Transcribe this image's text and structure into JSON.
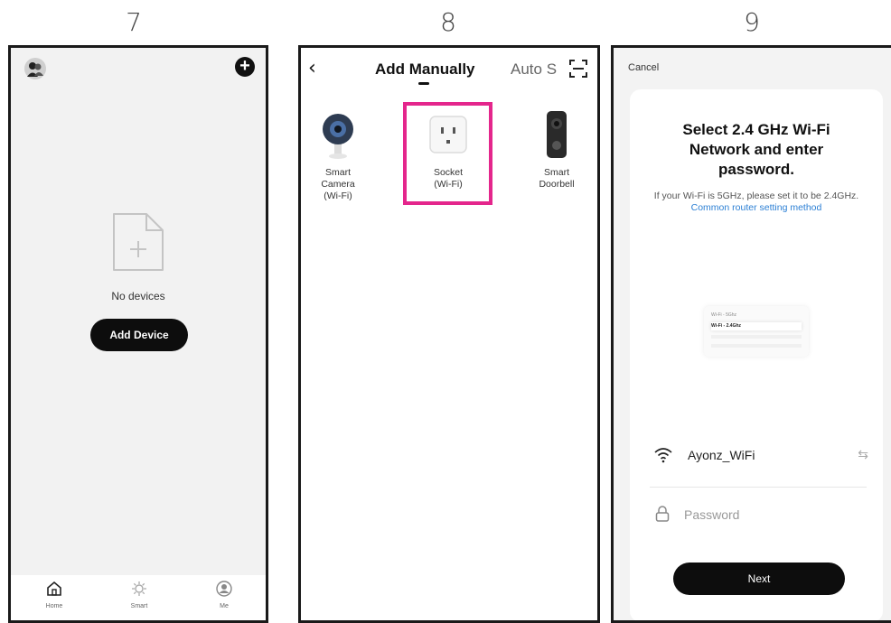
{
  "steps": [
    "7",
    "8",
    "9"
  ],
  "screen7": {
    "empty_text": "No devices",
    "add_device_label": "Add Device",
    "tabs": [
      "Home",
      "Smart",
      "Me"
    ]
  },
  "screen8": {
    "tab_manual": "Add Manually",
    "tab_auto": "Auto S",
    "devices": [
      {
        "line1": "Smart",
        "line2": "Camera",
        "line3": "(Wi-Fi)"
      },
      {
        "line1": "Socket",
        "line2": "(Wi-Fi)"
      },
      {
        "line1": "Smart",
        "line2": "Doorbell"
      }
    ],
    "highlight_color": "#e4268c"
  },
  "screen9": {
    "cancel_label": "Cancel",
    "title_line1": "Select 2.4 GHz Wi-Fi",
    "title_line2": "Network and enter",
    "title_line3": "password.",
    "subtitle": "If your Wi-Fi is 5GHz, please set it to be 2.4GHz.",
    "link_text": "Common router setting method",
    "illustration": {
      "row1": "Wi-Fi - 5Ghz",
      "row2": "Wi-Fi - 2.4Ghz"
    },
    "ssid": "Ayonz_WiFi",
    "password_placeholder": "Password",
    "next_label": "Next",
    "link_color": "#2b7fd4"
  }
}
